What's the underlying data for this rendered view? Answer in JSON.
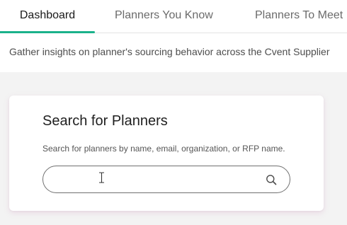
{
  "tabs": [
    {
      "label": "Dashboard",
      "active": true
    },
    {
      "label": "Planners You Know",
      "active": false
    },
    {
      "label": "Planners To Meet",
      "active": false
    }
  ],
  "subtitle": "Gather insights on planner's sourcing behavior across the Cvent Supplier",
  "search_card": {
    "title": "Search for Planners",
    "description": "Search for planners by name, email, organization, or RFP name.",
    "input_value": "",
    "icon": "search-icon"
  },
  "colors": {
    "accent": "#1bb28b",
    "background": "#f3f3f3"
  }
}
